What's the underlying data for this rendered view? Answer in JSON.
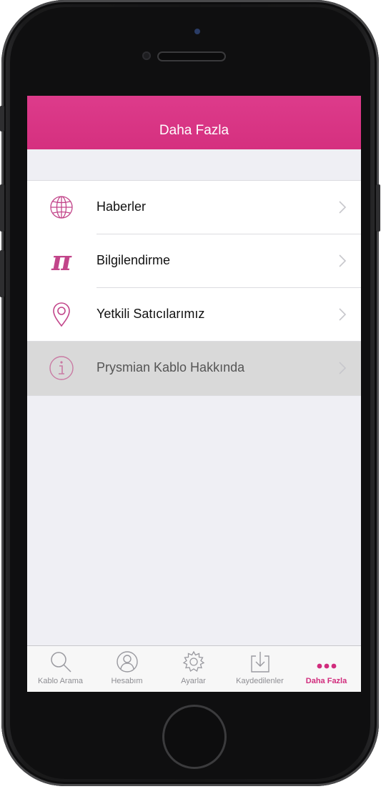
{
  "nav": {
    "title": "Daha Fazla"
  },
  "menu": [
    {
      "label": "Haberler",
      "icon": "globe-icon"
    },
    {
      "label": "Bilgilendirme",
      "icon": "pi-icon",
      "glyph": "π"
    },
    {
      "label": "Yetkili Satıcılarımız",
      "icon": "location-pin-icon"
    },
    {
      "label": "Prysmian Kablo Hakkında",
      "icon": "info-icon",
      "selected": true
    }
  ],
  "tabs": [
    {
      "label": "Kablo Arama",
      "icon": "search-icon"
    },
    {
      "label": "Hesabım",
      "icon": "user-icon"
    },
    {
      "label": "Ayarlar",
      "icon": "gear-icon"
    },
    {
      "label": "Kaydedilenler",
      "icon": "download-icon"
    },
    {
      "label": "Daha Fazla",
      "icon": "more-dots-icon",
      "active": true
    }
  ],
  "colors": {
    "accent": "#d12c7d",
    "navbar": "#d9357f",
    "background": "#efeff4"
  }
}
